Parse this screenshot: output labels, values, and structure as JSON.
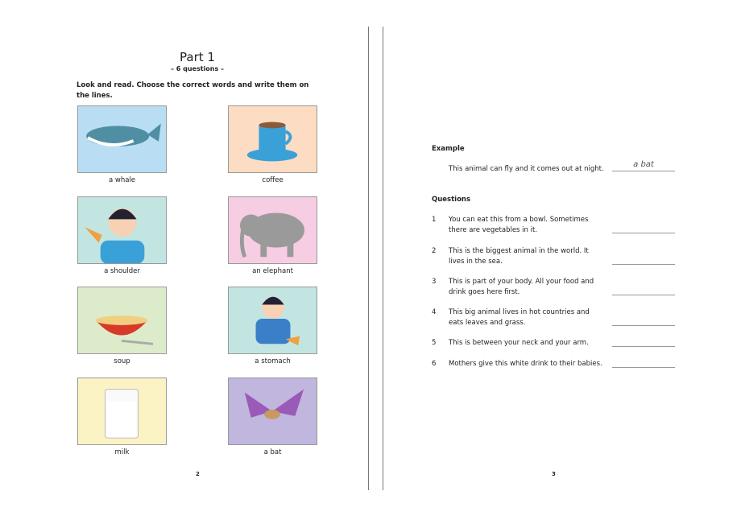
{
  "left_page": {
    "title": "Part 1",
    "subtitle": "– 6 questions –",
    "instruction": "Look and read. Choose the correct words and write them on the lines.",
    "page_number": "2",
    "pictures": [
      {
        "label": "a whale",
        "bg": "#b9def3"
      },
      {
        "label": "coffee",
        "bg": "#fcdcc2"
      },
      {
        "label": "a shoulder",
        "bg": "#c2e5e2"
      },
      {
        "label": "an elephant",
        "bg": "#f6cde2"
      },
      {
        "label": "soup",
        "bg": "#dcecca"
      },
      {
        "label": "a stomach",
        "bg": "#c2e5e2"
      },
      {
        "label": "milk",
        "bg": "#fbf3c3"
      },
      {
        "label": "a bat",
        "bg": "#c0b6de"
      }
    ]
  },
  "right_page": {
    "example_heading": "Example",
    "example_text": "This animal can fly and it comes out at night.",
    "example_answer": "a bat",
    "questions_heading": "Questions",
    "page_number": "3",
    "questions": [
      {
        "n": "1",
        "text": "You can eat this from a bowl. Sometimes there are vegetables in it."
      },
      {
        "n": "2",
        "text": "This is the biggest animal in the world. It lives in the sea."
      },
      {
        "n": "3",
        "text": "This is part of your body. All your food and drink goes here first."
      },
      {
        "n": "4",
        "text": "This big animal lives in hot countries and eats leaves and grass."
      },
      {
        "n": "5",
        "text": "This is between your neck and your arm."
      },
      {
        "n": "6",
        "text": "Mothers give this white drink to their babies."
      }
    ]
  }
}
